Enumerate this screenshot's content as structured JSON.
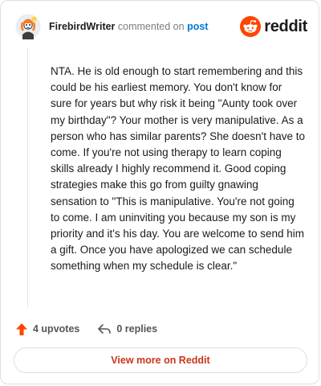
{
  "comment": {
    "author": "FirebirdWriter",
    "action": "commented on",
    "post_link": "post",
    "body": "NTA. He is old enough to start remembering and this could be his earliest memory. You don't know for sure for years but why risk it being \"Aunty took over my birthday\"? Your mother is very manipulative. As a person who has similar parents? She doesn't have to come. If you're not using therapy to learn coping skills already I highly recommend it. Good coping strategies make this go from guilty gnawing sensation to \"This is manipulative. You're not going to come. I am uninviting you because my son is my priority and it's his day. You are welcome to send him a gift. Once you have apologized we can schedule something when my schedule is clear.\""
  },
  "brand": {
    "name": "reddit",
    "color": "#ff4500"
  },
  "footer": {
    "upvotes": "4 upvotes",
    "replies": "0 replies",
    "view_more": "View more on Reddit"
  },
  "icons": {
    "avatar": "avatar-icon",
    "logo": "reddit-logo-icon",
    "upvote": "upvote-arrow-icon",
    "reply": "reply-arrow-icon"
  }
}
